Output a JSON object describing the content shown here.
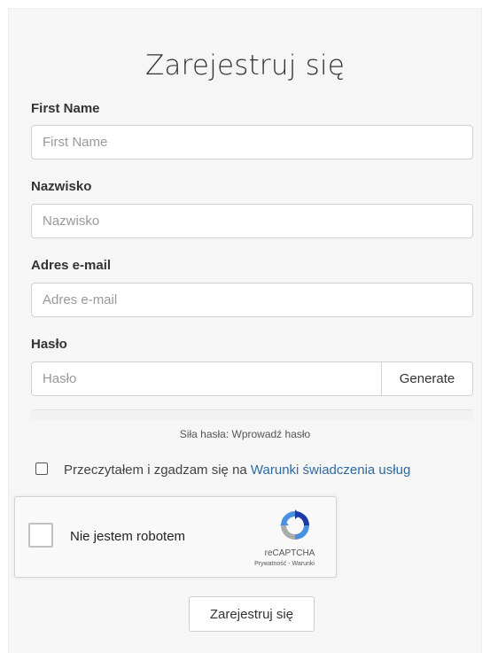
{
  "form": {
    "title": "Zarejestruj się",
    "first_name": {
      "label": "First Name",
      "placeholder": "First Name",
      "value": ""
    },
    "last_name": {
      "label": "Nazwisko",
      "placeholder": "Nazwisko",
      "value": ""
    },
    "email": {
      "label": "Adres e-mail",
      "placeholder": "Adres e-mail",
      "value": ""
    },
    "password": {
      "label": "Hasło",
      "placeholder": "Hasło",
      "value": "",
      "generate_label": "Generate"
    },
    "strength_text": "Siła hasła: Wprowadź hasło",
    "tos": {
      "text": "Przeczytałem i zgadzam się na ",
      "link": "Warunki świadczenia usług",
      "checked": false
    },
    "submit_label": "Zarejestruj się"
  },
  "recaptcha": {
    "label": "Nie jestem robotem",
    "brand": "reCAPTCHA",
    "links": "Prywatność - Warunki",
    "icon": "recaptcha-logo-icon",
    "checked": false
  },
  "colors": {
    "panel_bg": "#f6f6f6",
    "link": "#2b6aa5",
    "recaptcha_blue": "#4a90e2"
  }
}
